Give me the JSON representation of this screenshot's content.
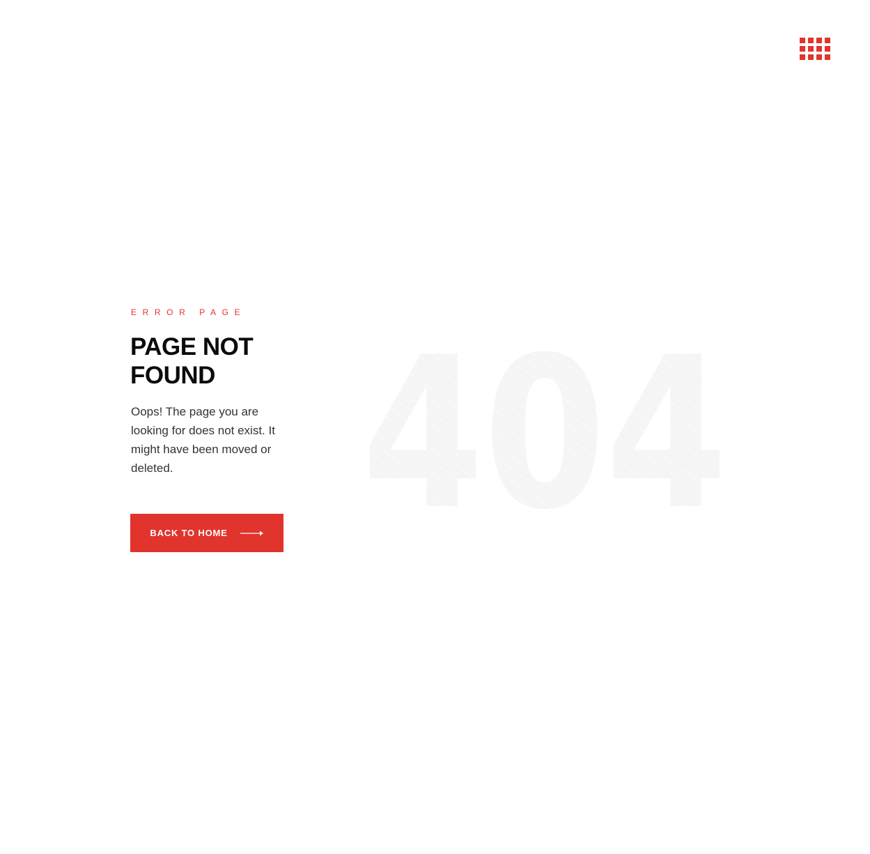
{
  "header": {
    "menu_icon": "grid-menu-icon"
  },
  "error": {
    "eyebrow": "ERROR PAGE",
    "title": "PAGE NOT FOUND",
    "description": "Oops! The page you are looking for does not exist. It might have been moved or deleted.",
    "button_label": "BACK TO HOME",
    "button_icon": "arrow-right-icon",
    "big_code": "404"
  },
  "colors": {
    "accent": "#e0342c",
    "title": "#0b0b0b",
    "text": "#333333",
    "watermark": "#f4f4f4",
    "scrollbar": "#4a4a4a"
  }
}
